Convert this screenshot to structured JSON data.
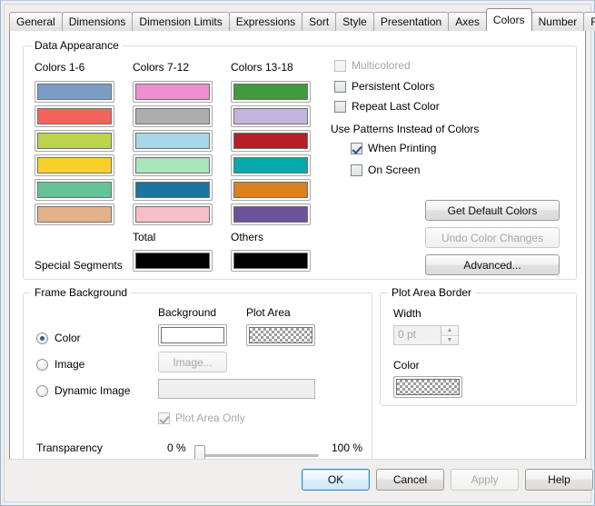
{
  "tabs": {
    "items": [
      {
        "label": "General",
        "active": false
      },
      {
        "label": "Dimensions",
        "active": false
      },
      {
        "label": "Dimension Limits",
        "active": false
      },
      {
        "label": "Expressions",
        "active": false
      },
      {
        "label": "Sort",
        "active": false
      },
      {
        "label": "Style",
        "active": false
      },
      {
        "label": "Presentation",
        "active": false
      },
      {
        "label": "Axes",
        "active": false
      },
      {
        "label": "Colors",
        "active": true
      },
      {
        "label": "Number",
        "active": false
      },
      {
        "label": "Font",
        "active": false
      }
    ],
    "scroll_left": "◂",
    "scroll_right": "▸"
  },
  "data_appearance": {
    "legend": "Data Appearance",
    "column_headers": [
      "Colors 1-6",
      "Colors 7-12",
      "Colors 13-18"
    ],
    "columns": [
      [
        "#7b9cc4",
        "#f4645a",
        "#bcd44e",
        "#fbd02a",
        "#62c498",
        "#e5b18a"
      ],
      [
        "#ee8fcf",
        "#adadad",
        "#a8d7ea",
        "#a8e5b8",
        "#1c759e",
        "#f8bfc9"
      ],
      [
        "#3f9a3c",
        "#c4b5dd",
        "#b51f26",
        "#06aaa9",
        "#d9811f",
        "#6a5398"
      ]
    ],
    "special_segments_label": "Special Segments",
    "total_label": "Total",
    "total_color": "#000000",
    "others_label": "Others",
    "others_color": "#000000"
  },
  "options": {
    "multicolored": {
      "label": "Multicolored",
      "checked": false,
      "enabled": false
    },
    "persistent_colors": {
      "label": "Persistent Colors",
      "checked": false,
      "enabled": true
    },
    "repeat_last_color": {
      "label": "Repeat Last Color",
      "checked": false,
      "enabled": true
    },
    "patterns_heading": "Use Patterns Instead of Colors",
    "when_printing": {
      "label": "When Printing",
      "checked": true,
      "enabled": true
    },
    "on_screen": {
      "label": "On Screen",
      "checked": false,
      "enabled": true
    }
  },
  "buttons": {
    "get_default_colors": {
      "label": "Get Default Colors",
      "enabled": true
    },
    "undo_color_changes": {
      "label": "Undo Color Changes",
      "enabled": false
    },
    "advanced": {
      "label": "Advanced...",
      "enabled": true
    }
  },
  "frame_background": {
    "legend": "Frame Background",
    "background_label": "Background",
    "plot_area_label": "Plot Area",
    "color_radio": {
      "label": "Color",
      "selected": true
    },
    "image_radio": {
      "label": "Image",
      "selected": false
    },
    "dynamic_image_radio": {
      "label": "Dynamic Image",
      "selected": false
    },
    "background_color": "#ffffff",
    "plot_area_color": "checkered",
    "image_button": {
      "label": "Image...",
      "enabled": false
    },
    "dynamic_image_value": "",
    "plot_area_only": {
      "label": "Plot Area Only",
      "checked": true,
      "enabled": false
    },
    "transparency_label": "Transparency",
    "transparency_min": "0 %",
    "transparency_max": "100 %",
    "transparency_value": 0
  },
  "plot_area_border": {
    "legend": "Plot Area Border",
    "width_label": "Width",
    "width_value": "0 pt",
    "width_enabled": false,
    "color_label": "Color",
    "color": "checkered"
  },
  "dialog_buttons": {
    "ok": {
      "label": "OK",
      "enabled": true,
      "default": true
    },
    "cancel": {
      "label": "Cancel",
      "enabled": true
    },
    "apply": {
      "label": "Apply",
      "enabled": false
    },
    "help": {
      "label": "Help",
      "enabled": true
    }
  }
}
